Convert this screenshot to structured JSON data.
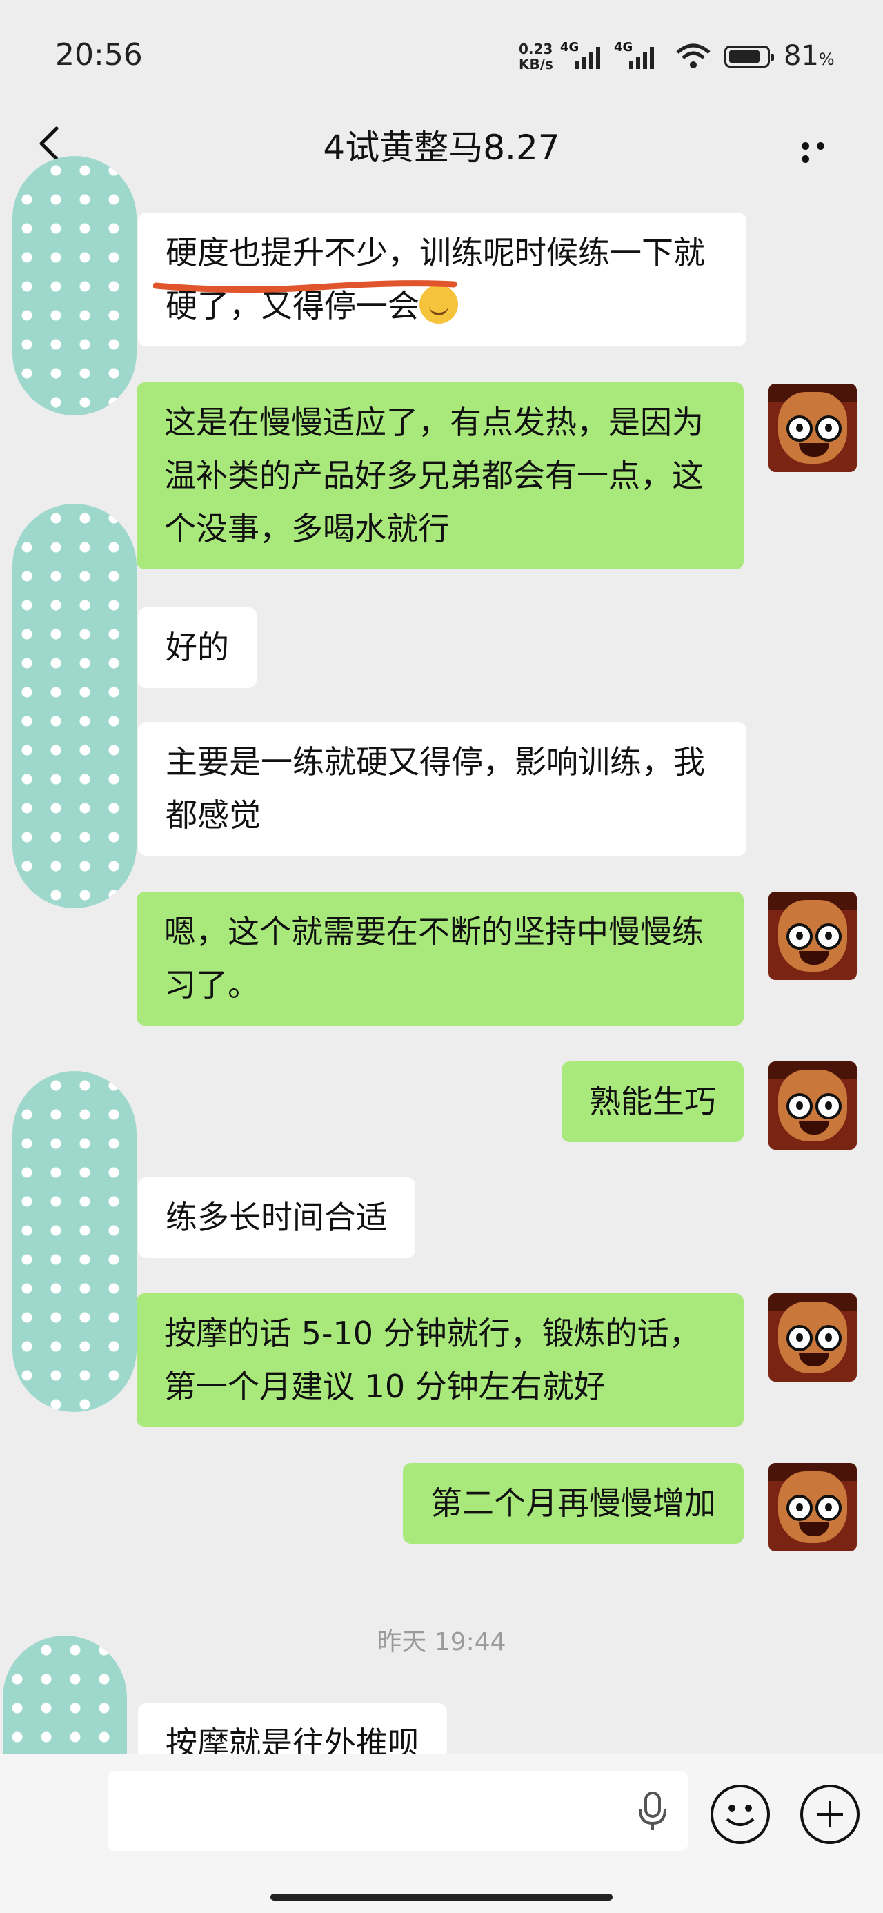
{
  "status_bar": {
    "time": "20:56",
    "net_speed": "0.23",
    "net_unit": "KB/s",
    "network1": "4G",
    "network2": "4G",
    "battery": "81",
    "battery_unit": "%"
  },
  "nav": {
    "title": "4试黄整马8.27"
  },
  "messages": [
    {
      "side": "in",
      "text": "硬度也提升不少，训练呢时候练一下就硬了，又得停一会"
    },
    {
      "side": "out",
      "text": "这是在慢慢适应了，有点发热，是因为温补类的产品好多兄弟都会有一点，这个没事，多喝水就行"
    },
    {
      "side": "in",
      "text": "好的"
    },
    {
      "side": "in",
      "text": "主要是一练就硬又得停，影响训练，我都感觉"
    },
    {
      "side": "out",
      "text": "嗯，这个就需要在不断的坚持中慢慢练习了。"
    },
    {
      "side": "out",
      "text": "熟能生巧"
    },
    {
      "side": "in",
      "text": "练多长时间合适"
    },
    {
      "side": "out",
      "text": "按摩的话 5-10 分钟就行，锻炼的话，第一个月建议 10 分钟左右就好"
    },
    {
      "side": "out",
      "text": "第二个月再慢慢增加"
    },
    {
      "side": "in",
      "text": "按摩就是往外推呗"
    }
  ],
  "timestamp": "昨天 19:44",
  "colors": {
    "background": "#ededed",
    "incoming_bubble": "#ffffff",
    "outgoing_bubble": "#a9e97b",
    "annotation_underline": "#e0552b"
  },
  "icons": {
    "back": "chevron-left-icon",
    "more": "more-dots-icon",
    "mic": "microphone-icon",
    "emoji": "emoji-icon",
    "add": "plus-circle-icon"
  }
}
